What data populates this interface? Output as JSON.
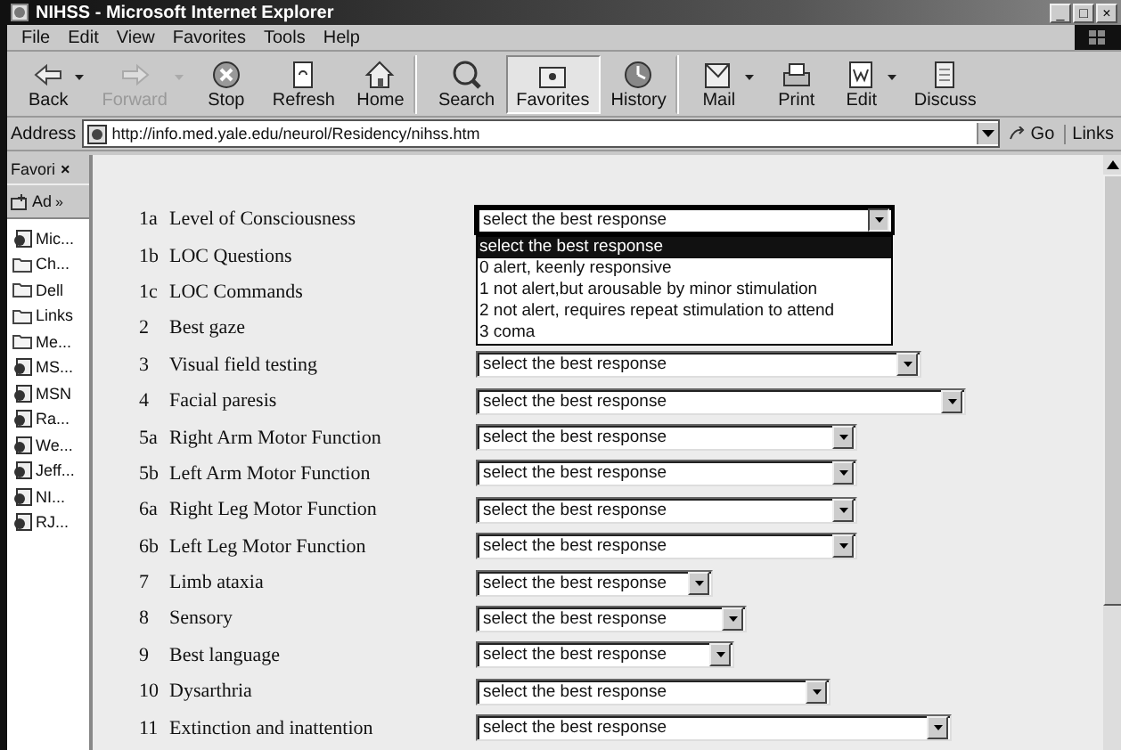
{
  "window": {
    "title": "NIHSS - Microsoft Internet Explorer",
    "controls": [
      "_",
      "□",
      "×"
    ]
  },
  "menu": [
    "File",
    "Edit",
    "View",
    "Favorites",
    "Tools",
    "Help"
  ],
  "toolbar": [
    {
      "kind": "back",
      "label": "Back",
      "dropdown": true,
      "disabled": false,
      "selected": false,
      "group_end": false
    },
    {
      "kind": "forward",
      "label": "Forward",
      "dropdown": true,
      "disabled": true,
      "selected": false,
      "group_end": false
    },
    {
      "kind": "stop",
      "label": "Stop",
      "dropdown": false,
      "disabled": false,
      "selected": false,
      "group_end": false
    },
    {
      "kind": "refresh",
      "label": "Refresh",
      "dropdown": false,
      "disabled": false,
      "selected": false,
      "group_end": false
    },
    {
      "kind": "home",
      "label": "Home",
      "dropdown": false,
      "disabled": false,
      "selected": false,
      "group_end": true
    },
    {
      "kind": "search",
      "label": "Search",
      "dropdown": false,
      "disabled": false,
      "selected": false,
      "group_end": false
    },
    {
      "kind": "favorites",
      "label": "Favorites",
      "dropdown": false,
      "disabled": false,
      "selected": true,
      "group_end": false
    },
    {
      "kind": "history",
      "label": "History",
      "dropdown": false,
      "disabled": false,
      "selected": false,
      "group_end": true
    },
    {
      "kind": "mail",
      "label": "Mail",
      "dropdown": true,
      "disabled": false,
      "selected": false,
      "group_end": false
    },
    {
      "kind": "print",
      "label": "Print",
      "dropdown": false,
      "disabled": false,
      "selected": false,
      "group_end": false
    },
    {
      "kind": "edit",
      "label": "Edit",
      "dropdown": true,
      "disabled": false,
      "selected": false,
      "group_end": false
    },
    {
      "kind": "discuss",
      "label": "Discuss",
      "dropdown": false,
      "disabled": false,
      "selected": false,
      "group_end": false
    }
  ],
  "address": {
    "label": "Address",
    "value": "http://info.med.yale.edu/neurol/Residency/nihss.htm",
    "go": "Go",
    "links": "Links"
  },
  "favorites_pane": {
    "title": "Favori",
    "close": "×",
    "add": "Ad",
    "more": "»",
    "items": [
      {
        "kind": "page",
        "label": "Mic..."
      },
      {
        "kind": "folder",
        "label": "Ch..."
      },
      {
        "kind": "folder",
        "label": "Dell"
      },
      {
        "kind": "folder",
        "label": "Links"
      },
      {
        "kind": "folder",
        "label": "Me..."
      },
      {
        "kind": "page",
        "label": "MS..."
      },
      {
        "kind": "page",
        "label": "MSN"
      },
      {
        "kind": "page",
        "label": "Ra..."
      },
      {
        "kind": "page",
        "label": "We..."
      },
      {
        "kind": "page",
        "label": "Jeff..."
      },
      {
        "kind": "page",
        "label": "NI..."
      },
      {
        "kind": "page",
        "label": "RJ..."
      }
    ]
  },
  "items": [
    {
      "number": "1a",
      "label": "Level of Consciousness",
      "value": "select the best response",
      "expanded": true,
      "options": [
        {
          "label": "select the best response",
          "selected": true
        },
        {
          "label": "0 alert, keenly responsive",
          "selected": false
        },
        {
          "label": "1 not alert,but arousable by minor stimulation",
          "selected": false
        },
        {
          "label": "2 not alert, requires repeat stimulation to attend",
          "selected": false
        },
        {
          "label": "3 coma",
          "selected": false
        }
      ]
    },
    {
      "number": "1b",
      "label": "LOC Questions"
    },
    {
      "number": "1c",
      "label": "LOC Commands"
    },
    {
      "number": "2",
      "label": "Best gaze"
    },
    {
      "number": "3",
      "label": "Visual field testing",
      "value": "select the best response",
      "expanded": false
    },
    {
      "number": "4",
      "label": "Facial paresis",
      "value": "select the best response",
      "expanded": false
    },
    {
      "number": "5a",
      "label": "Right Arm Motor Function",
      "value": "select the best response",
      "expanded": false
    },
    {
      "number": "5b",
      "label": "Left Arm Motor Function",
      "value": "select the best response",
      "expanded": false
    },
    {
      "number": "6a",
      "label": "Right Leg Motor Function",
      "value": "select the best response",
      "expanded": false
    },
    {
      "number": "6b",
      "label": "Left Leg Motor Function",
      "value": "select the best response",
      "expanded": false
    },
    {
      "number": "7",
      "label": "Limb ataxia",
      "value": "select the best response",
      "expanded": false
    },
    {
      "number": "8",
      "label": "Sensory",
      "value": "select the best response",
      "expanded": false
    },
    {
      "number": "9",
      "label": "Best language",
      "value": "select the best response",
      "expanded": false
    },
    {
      "number": "10",
      "label": "Dysarthria",
      "value": "select the best response",
      "expanded": false
    },
    {
      "number": "11",
      "label": "Extinction and inattention",
      "value": "select the best response",
      "expanded": false
    }
  ]
}
